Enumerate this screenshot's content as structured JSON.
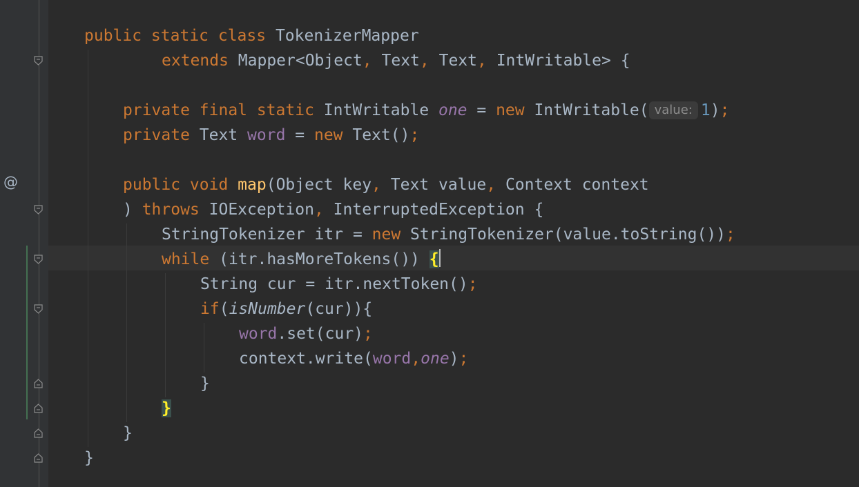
{
  "editor": {
    "colors": {
      "background": "#2b2b2b",
      "gutter": "#313335",
      "keyword": "#cc7832",
      "plain": "#a9b7c6",
      "field": "#9876aa",
      "method": "#ffc66d",
      "number": "#6897bb",
      "brace_match": "#ffef28"
    },
    "gutter_icons": {
      "override_marker": "@"
    },
    "code": {
      "l1": {
        "t1": "public static class ",
        "t2": "TokenizerMapper"
      },
      "l2": {
        "t1": "extends ",
        "t2": "Mapper<Object",
        "t3": ", ",
        "t4": "Text",
        "t5": ", ",
        "t6": "Text",
        "t7": ", ",
        "t8": "IntWritable> {"
      },
      "l4": {
        "t1": "private final static ",
        "t2": "IntWritable ",
        "t3": "one",
        "t4": " = ",
        "t5": "new ",
        "t6": "IntWritable(",
        "hint": "value:",
        "t7": "1",
        "t8": ")",
        "t9": ";"
      },
      "l5": {
        "t1": "private ",
        "t2": "Text ",
        "t3": "word",
        "t4": " = ",
        "t5": "new ",
        "t6": "Text()",
        "t7": ";"
      },
      "l7": {
        "t1": "public void ",
        "t2": "map",
        "t3": "(Object key",
        "t4": ", ",
        "t5": "Text value",
        "t6": ", ",
        "t7": "Context context"
      },
      "l8": {
        "t1": ") ",
        "t2": "throws ",
        "t3": "IOException",
        "t4": ", ",
        "t5": "InterruptedException {"
      },
      "l9": {
        "t1": "StringTokenizer itr = ",
        "t2": "new ",
        "t3": "StringTokenizer(value.toString())",
        "t4": ";"
      },
      "l10": {
        "t1": "while ",
        "t2": "(itr.hasMoreTokens()) ",
        "t3": "{"
      },
      "l11": {
        "t1": "String cur = itr.nextToken()",
        "t2": ";"
      },
      "l12": {
        "t1": "if",
        "t2": "(",
        "t3": "isNumber",
        "t4": "(cur)){"
      },
      "l13": {
        "t1": "word",
        "t2": ".set(cur)",
        "t3": ";"
      },
      "l14": {
        "t1": "context.write(",
        "t2": "word",
        "t3": ",",
        "t4": "one",
        "t5": ")",
        "t6": ";"
      },
      "l15": {
        "t1": "}"
      },
      "l16": {
        "t1": "}"
      },
      "l17": {
        "t1": "}"
      },
      "l18": {
        "t1": "}"
      }
    }
  }
}
